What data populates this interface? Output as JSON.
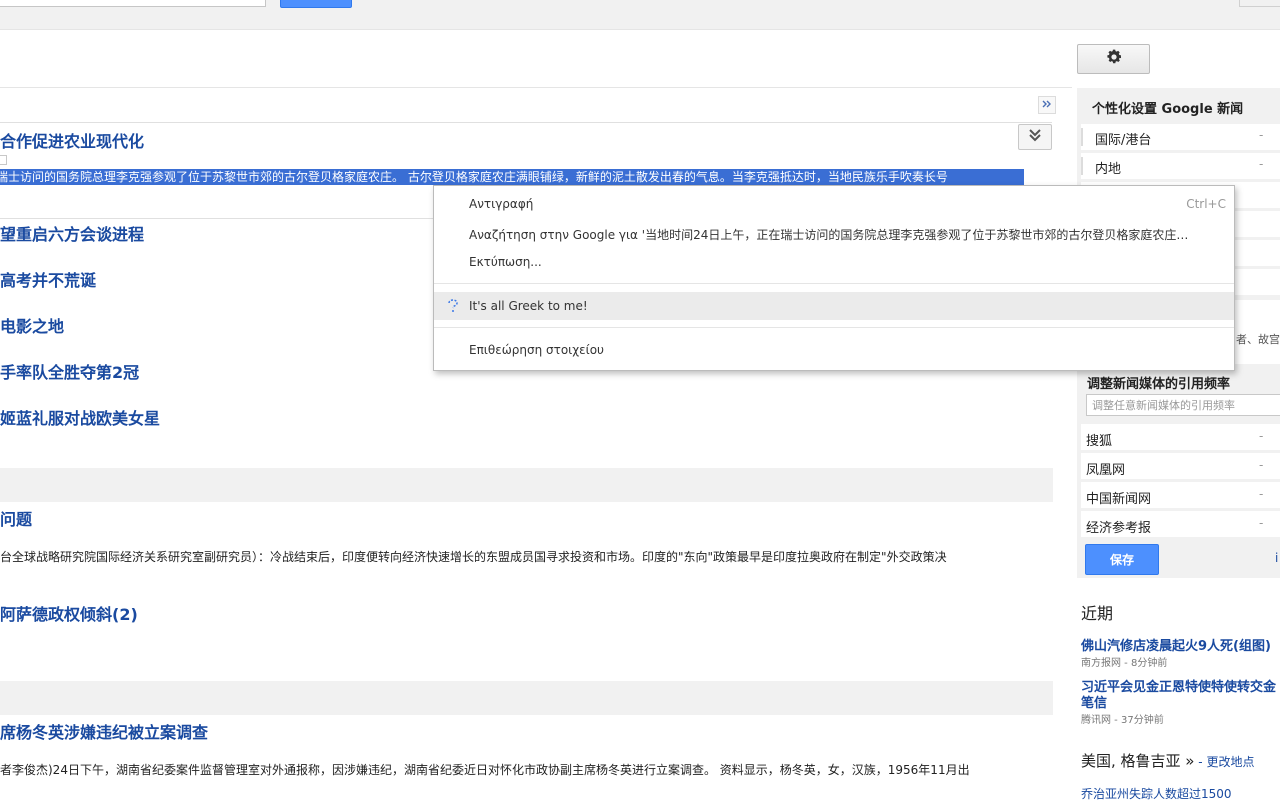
{
  "sidebar": {
    "title": "个性化设置 Google 新闻",
    "sections": [
      "国际/港台",
      "内地"
    ],
    "partial_text": "者、故宫",
    "dash": "-",
    "media_title": "调整新闻媒体的引用频率",
    "media_placeholder": "调整任意新闻媒体的引用频率",
    "media": [
      "搜狐",
      "凤凰网",
      "中国新闻网",
      "经济参考报"
    ],
    "save_label": "保存",
    "edge_char": "i"
  },
  "recent": {
    "title": "近期",
    "items": [
      {
        "headline": "佛山汽修店凌晨起火9人死(组图)",
        "source": "南方报网 - 8分钟前"
      },
      {
        "headline": "习近平会见金正恩特使特使转交金",
        "headline2": "笔信",
        "source": "腾讯网 - 37分钟前"
      }
    ]
  },
  "location": {
    "title": "美国, 格鲁吉亚 »",
    "change": " - 更改地点",
    "item": "乔治亚州失踪人数超过1500"
  },
  "main": {
    "top_headline": "合作促进农业现代化",
    "selected_snippet": "瑞士访问的国务院总理李克强参观了位于苏黎世市郊的古尔登贝格家庭农庄。 古尔登贝格家庭农庄满眼铺绿，新鲜的泥土散发出春的气息。当李克强抵达时，当地民族乐手吹奏长号",
    "headlines_a": [
      "望重启六方会谈进程",
      "高考并不荒诞",
      "电影之地",
      "手率队全胜夺第2冠",
      "姬蓝礼服对战欧美女星"
    ],
    "story2_headline": "问题",
    "story2_snippet": "台全球战略研究院国际经济关系研究室副研究员）：冷战结束后，印度便转向经济快速增长的东盟成员国寻求投资和市场。印度的\"东向\"政策最早是印度拉奥政府在制定\"外交政策决",
    "story3_headline": "阿萨德政权倾斜(2)",
    "story4_headline": "席杨冬英涉嫌违纪被立案调查",
    "story4_snippet": "者李俊杰)24日下午，湖南省纪委案件监督管理室对外通报称，因涉嫌违纪，湖南省纪委近日对怀化市政协副主席杨冬英进行立案调查。 资料显示，杨冬英，女，汉族，1956年11月出"
  },
  "context_menu": {
    "copy": "Αντιγραφή",
    "copy_shortcut": "Ctrl+C",
    "search": "Αναζήτηση στην Google για '当地时间24日上午，正在瑞士访问的国务院总理李克强参观了位于苏黎世市郊的古尔登贝格家庭农庄…",
    "print": "Εκτύπωση...",
    "greek": "It's all Greek to me!",
    "inspect": "Επιθεώρηση στοιχείου"
  },
  "icons": {
    "gear": "gear-icon",
    "collapse": "double-chevron-right-icon",
    "expand": "double-chevron-down-icon",
    "extension": "question-icon"
  },
  "colors": {
    "link": "#1a4aa0",
    "accent": "#4d90fe",
    "selection": "#3a6ed4"
  }
}
